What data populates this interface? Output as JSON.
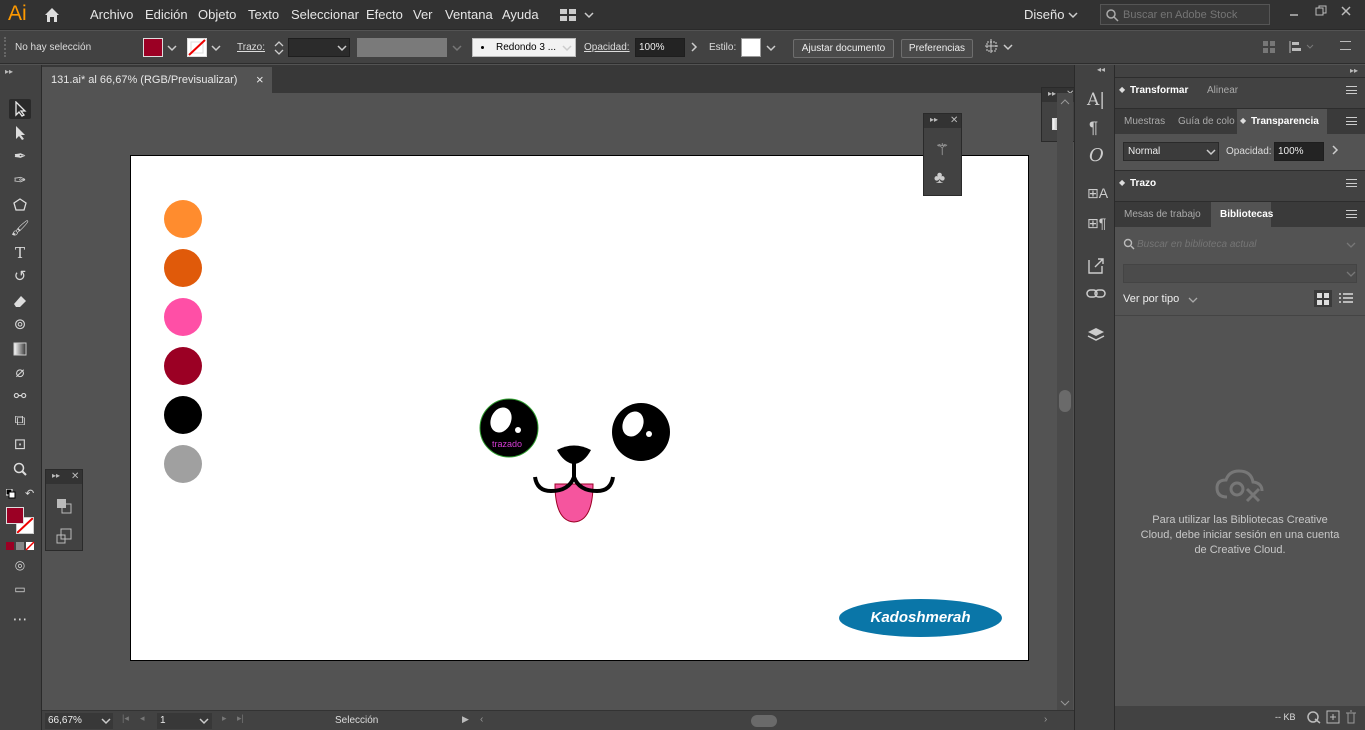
{
  "app": {
    "logo": "Ai",
    "workspace": "Diseño",
    "stock_search_placeholder": "Buscar en Adobe Stock"
  },
  "menu": [
    "Archivo",
    "Edición",
    "Objeto",
    "Texto",
    "Seleccionar",
    "Efecto",
    "Ver",
    "Ventana",
    "Ayuda"
  ],
  "control": {
    "selection": "No hay selección",
    "stroke_label": "Trazo:",
    "brush": "Redondo 3 ...",
    "opacity_label": "Opacidad:",
    "opacity_value": "100%",
    "style_label": "Estilo:",
    "fit_button": "Ajustar documento",
    "prefs_button": "Preferencias"
  },
  "document": {
    "tab_title": "131.ai* al 66,67% (RGB/Previsualizar)",
    "close": "×"
  },
  "artboard": {
    "swatches": [
      "#FF8C2E",
      "#E05A0A",
      "#FF4FA6",
      "#9B0024",
      "#000000",
      "#A0A0A0"
    ],
    "hover_label": "trazado",
    "signature": "Kadoshmerah",
    "signature_color": "#0A76A8",
    "tongue_color": "#F5559E"
  },
  "status": {
    "zoom": "66,67%",
    "page": "1",
    "tool": "Selección"
  },
  "colors": {
    "fill": "#9B0024",
    "accent_orange": "#FF9A00"
  },
  "panels": {
    "transform_tabs": [
      "Transformar",
      "Alinear"
    ],
    "color_tabs": [
      "Muestras",
      "Guía de colo",
      "Transparencia"
    ],
    "blend_mode": "Normal",
    "opacity_label": "Opacidad:",
    "opacity_value": "100%",
    "stroke_panel": "Trazo",
    "lib_tabs": [
      "Mesas de trabajo",
      "Bibliotecas"
    ],
    "lib_search_placeholder": "Buscar en biblioteca actual",
    "view_by": "Ver por tipo",
    "lib_message": "Para utilizar las Bibliotecas Creative Cloud, debe iniciar sesión en una cuenta de Creative Cloud.",
    "lib_size": "-- KB"
  }
}
